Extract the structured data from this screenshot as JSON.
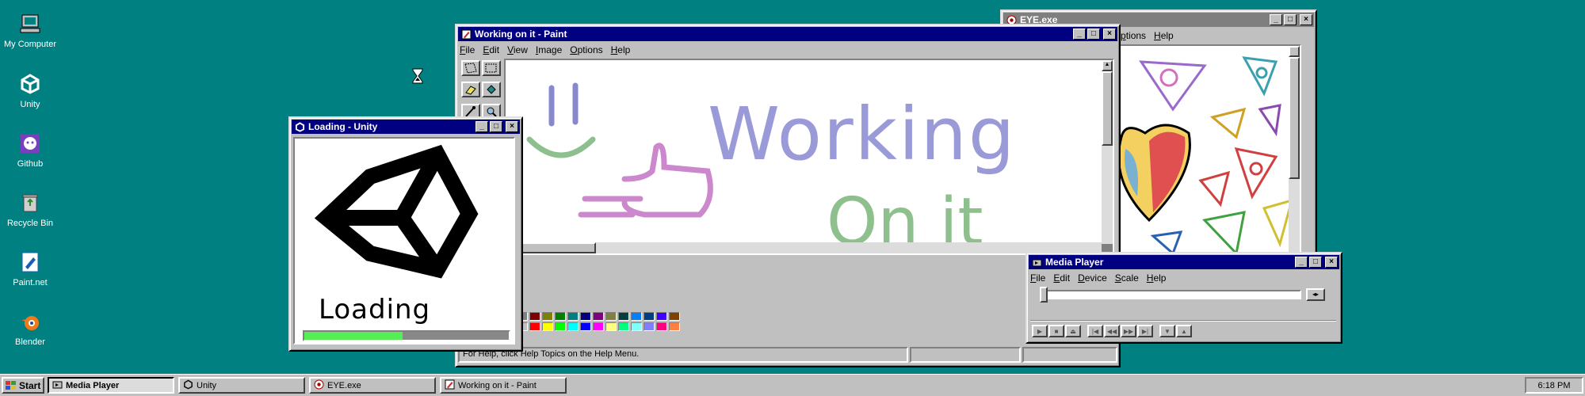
{
  "desktop": {
    "icons": [
      {
        "label": "My Computer",
        "icon": "computer-icon"
      },
      {
        "label": "Unity",
        "icon": "unity-icon"
      },
      {
        "label": "Github",
        "icon": "github-icon"
      },
      {
        "label": "Recycle Bin",
        "icon": "recycle-bin-icon"
      },
      {
        "label": "Paint.net",
        "icon": "paintnet-icon"
      },
      {
        "label": "Blender",
        "icon": "blender-icon"
      }
    ],
    "background_color": "#008080"
  },
  "paint": {
    "title": "Working on it - Paint",
    "menu": [
      "File",
      "Edit",
      "View",
      "Image",
      "Options",
      "Help"
    ],
    "status": "For Help, click Help Topics on the Help Menu.",
    "canvas_text": {
      "line1": "Working",
      "line2": "On it"
    },
    "palette": [
      "#000000",
      "#808080",
      "#800000",
      "#808000",
      "#008000",
      "#008080",
      "#000080",
      "#800080",
      "#808040",
      "#004040",
      "#0080ff",
      "#004080",
      "#4000ff",
      "#804000",
      "#ffffff",
      "#c0c0c0",
      "#ff0000",
      "#ffff00",
      "#00ff00",
      "#00ffff",
      "#0000ff",
      "#ff00ff",
      "#ffff80",
      "#00ff80",
      "#80ffff",
      "#8080ff",
      "#ff0080",
      "#ff8040"
    ]
  },
  "unity_loading": {
    "title": "Loading - Unity",
    "text": "Loading",
    "progress": 0.48
  },
  "eye": {
    "title": "EYE.exe",
    "menu_partial": "ptions",
    "menu_help": "Help"
  },
  "media_player": {
    "title": "Media Player",
    "menu": [
      "File",
      "Edit",
      "Device",
      "Scale",
      "Help"
    ],
    "controls": [
      "play-icon",
      "stop-icon",
      "eject-icon",
      "skip-start-icon",
      "rewind-icon",
      "forward-icon",
      "skip-end-icon",
      "mark-in-icon",
      "mark-out-icon"
    ]
  },
  "taskbar": {
    "start": "Start",
    "tasks": [
      {
        "label": "Media Player",
        "icon": "media-player-icon",
        "active": true
      },
      {
        "label": "Unity",
        "icon": "unity-icon",
        "active": false
      },
      {
        "label": "EYE.exe",
        "icon": "eye-icon",
        "active": false
      },
      {
        "label": "Working on it - Paint",
        "icon": "paint-icon",
        "active": false
      }
    ],
    "clock": "6:18 PM"
  },
  "colors": {
    "title_active": "#000080",
    "face": "#c0c0c0",
    "progress": "#55ee55"
  }
}
